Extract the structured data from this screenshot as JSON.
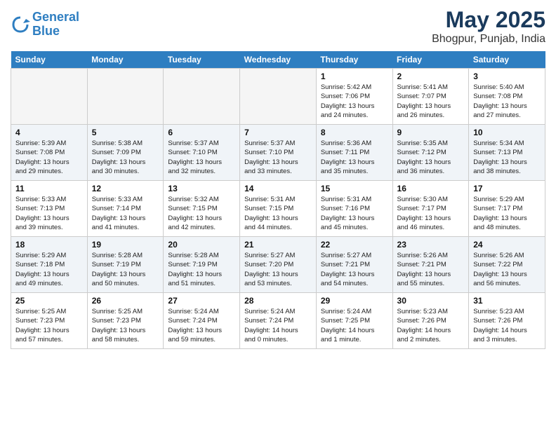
{
  "header": {
    "logo_line1": "General",
    "logo_line2": "Blue",
    "title": "May 2025",
    "subtitle": "Bhogpur, Punjab, India"
  },
  "days_of_week": [
    "Sunday",
    "Monday",
    "Tuesday",
    "Wednesday",
    "Thursday",
    "Friday",
    "Saturday"
  ],
  "weeks": [
    [
      {
        "day": "",
        "info": ""
      },
      {
        "day": "",
        "info": ""
      },
      {
        "day": "",
        "info": ""
      },
      {
        "day": "",
        "info": ""
      },
      {
        "day": "1",
        "info": "Sunrise: 5:42 AM\nSunset: 7:06 PM\nDaylight: 13 hours\nand 24 minutes."
      },
      {
        "day": "2",
        "info": "Sunrise: 5:41 AM\nSunset: 7:07 PM\nDaylight: 13 hours\nand 26 minutes."
      },
      {
        "day": "3",
        "info": "Sunrise: 5:40 AM\nSunset: 7:08 PM\nDaylight: 13 hours\nand 27 minutes."
      }
    ],
    [
      {
        "day": "4",
        "info": "Sunrise: 5:39 AM\nSunset: 7:08 PM\nDaylight: 13 hours\nand 29 minutes."
      },
      {
        "day": "5",
        "info": "Sunrise: 5:38 AM\nSunset: 7:09 PM\nDaylight: 13 hours\nand 30 minutes."
      },
      {
        "day": "6",
        "info": "Sunrise: 5:37 AM\nSunset: 7:10 PM\nDaylight: 13 hours\nand 32 minutes."
      },
      {
        "day": "7",
        "info": "Sunrise: 5:37 AM\nSunset: 7:10 PM\nDaylight: 13 hours\nand 33 minutes."
      },
      {
        "day": "8",
        "info": "Sunrise: 5:36 AM\nSunset: 7:11 PM\nDaylight: 13 hours\nand 35 minutes."
      },
      {
        "day": "9",
        "info": "Sunrise: 5:35 AM\nSunset: 7:12 PM\nDaylight: 13 hours\nand 36 minutes."
      },
      {
        "day": "10",
        "info": "Sunrise: 5:34 AM\nSunset: 7:13 PM\nDaylight: 13 hours\nand 38 minutes."
      }
    ],
    [
      {
        "day": "11",
        "info": "Sunrise: 5:33 AM\nSunset: 7:13 PM\nDaylight: 13 hours\nand 39 minutes."
      },
      {
        "day": "12",
        "info": "Sunrise: 5:33 AM\nSunset: 7:14 PM\nDaylight: 13 hours\nand 41 minutes."
      },
      {
        "day": "13",
        "info": "Sunrise: 5:32 AM\nSunset: 7:15 PM\nDaylight: 13 hours\nand 42 minutes."
      },
      {
        "day": "14",
        "info": "Sunrise: 5:31 AM\nSunset: 7:15 PM\nDaylight: 13 hours\nand 44 minutes."
      },
      {
        "day": "15",
        "info": "Sunrise: 5:31 AM\nSunset: 7:16 PM\nDaylight: 13 hours\nand 45 minutes."
      },
      {
        "day": "16",
        "info": "Sunrise: 5:30 AM\nSunset: 7:17 PM\nDaylight: 13 hours\nand 46 minutes."
      },
      {
        "day": "17",
        "info": "Sunrise: 5:29 AM\nSunset: 7:17 PM\nDaylight: 13 hours\nand 48 minutes."
      }
    ],
    [
      {
        "day": "18",
        "info": "Sunrise: 5:29 AM\nSunset: 7:18 PM\nDaylight: 13 hours\nand 49 minutes."
      },
      {
        "day": "19",
        "info": "Sunrise: 5:28 AM\nSunset: 7:19 PM\nDaylight: 13 hours\nand 50 minutes."
      },
      {
        "day": "20",
        "info": "Sunrise: 5:28 AM\nSunset: 7:19 PM\nDaylight: 13 hours\nand 51 minutes."
      },
      {
        "day": "21",
        "info": "Sunrise: 5:27 AM\nSunset: 7:20 PM\nDaylight: 13 hours\nand 53 minutes."
      },
      {
        "day": "22",
        "info": "Sunrise: 5:27 AM\nSunset: 7:21 PM\nDaylight: 13 hours\nand 54 minutes."
      },
      {
        "day": "23",
        "info": "Sunrise: 5:26 AM\nSunset: 7:21 PM\nDaylight: 13 hours\nand 55 minutes."
      },
      {
        "day": "24",
        "info": "Sunrise: 5:26 AM\nSunset: 7:22 PM\nDaylight: 13 hours\nand 56 minutes."
      }
    ],
    [
      {
        "day": "25",
        "info": "Sunrise: 5:25 AM\nSunset: 7:23 PM\nDaylight: 13 hours\nand 57 minutes."
      },
      {
        "day": "26",
        "info": "Sunrise: 5:25 AM\nSunset: 7:23 PM\nDaylight: 13 hours\nand 58 minutes."
      },
      {
        "day": "27",
        "info": "Sunrise: 5:24 AM\nSunset: 7:24 PM\nDaylight: 13 hours\nand 59 minutes."
      },
      {
        "day": "28",
        "info": "Sunrise: 5:24 AM\nSunset: 7:24 PM\nDaylight: 14 hours\nand 0 minutes."
      },
      {
        "day": "29",
        "info": "Sunrise: 5:24 AM\nSunset: 7:25 PM\nDaylight: 14 hours\nand 1 minute."
      },
      {
        "day": "30",
        "info": "Sunrise: 5:23 AM\nSunset: 7:26 PM\nDaylight: 14 hours\nand 2 minutes."
      },
      {
        "day": "31",
        "info": "Sunrise: 5:23 AM\nSunset: 7:26 PM\nDaylight: 14 hours\nand 3 minutes."
      }
    ]
  ]
}
